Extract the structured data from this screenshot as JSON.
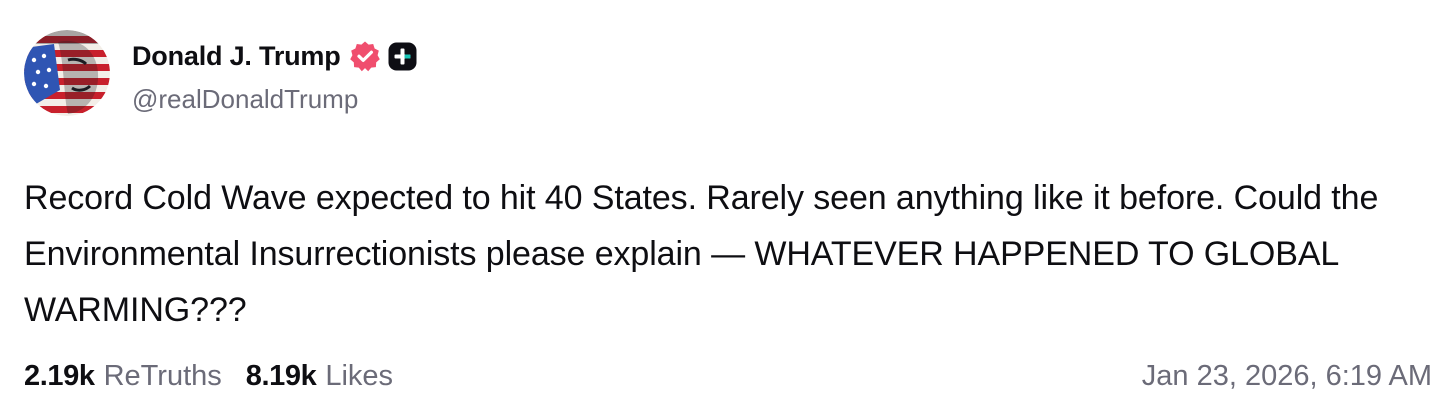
{
  "author": {
    "display_name": "Donald J. Trump",
    "handle": "@realDonaldTrump",
    "avatar_icon": "flag-portrait-avatar",
    "verified_icon": "verified-badge-icon",
    "verified_color": "#f04e6e",
    "plus_icon": "truth-plus-icon"
  },
  "post": {
    "text": "Record Cold Wave expected to hit 40 States. Rarely seen anything like it before. Could the Environmental Insurrectionists please explain — WHATEVER HAPPENED TO GLOBAL WARMING???"
  },
  "stats": {
    "retruths_count": "2.19k",
    "retruths_label": "ReTruths",
    "likes_count": "8.19k",
    "likes_label": "Likes"
  },
  "timestamp": "Jan 23, 2026, 6:19 AM",
  "colors": {
    "text": "#0e0e12",
    "muted": "#6b6b78",
    "background": "#ffffff"
  }
}
